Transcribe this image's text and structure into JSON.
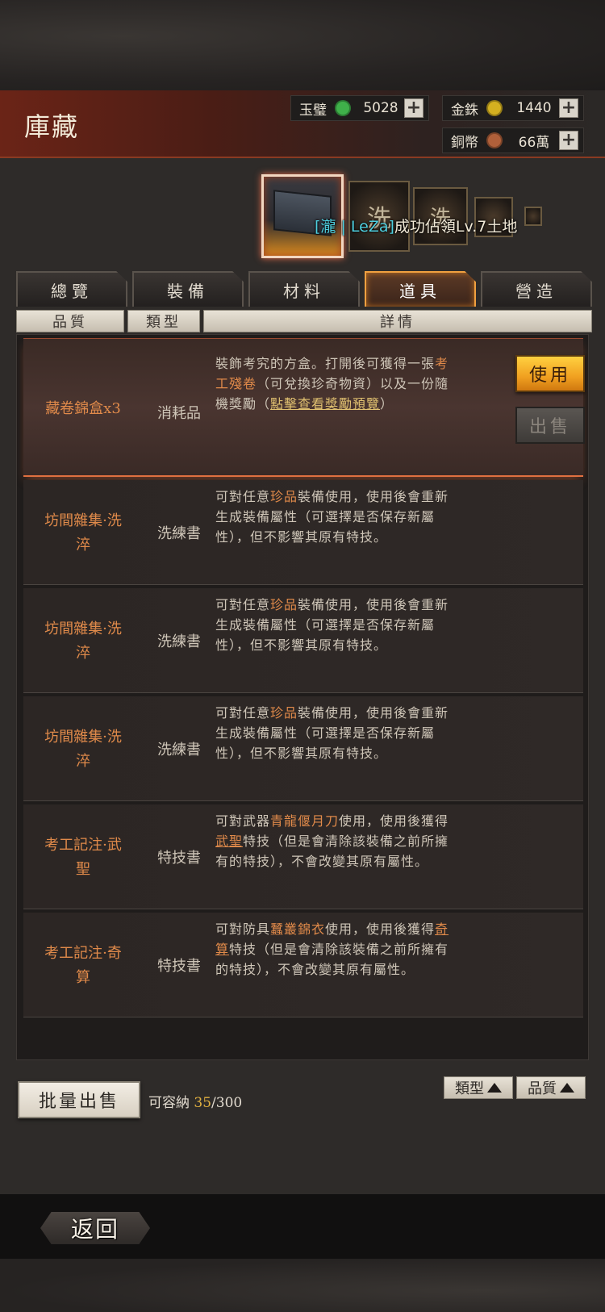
{
  "header": {
    "title": "庫藏"
  },
  "currencies": [
    {
      "label": "玉璧",
      "value": "5028",
      "coin_color": "#3fb04a"
    },
    {
      "label": "金銖",
      "value": "1440",
      "coin_color": "#d4b020"
    },
    {
      "label": "銅幣",
      "value": "66萬",
      "coin_color": "#b0603a"
    }
  ],
  "reward_glyphs": [
    "洗",
    "洗"
  ],
  "toast": {
    "alliance": "[瀧 | LeZa]",
    "message": "成功佔領Lv.7土地"
  },
  "tabs": [
    {
      "label": "總覽"
    },
    {
      "label": "裝備"
    },
    {
      "label": "材料"
    },
    {
      "label": "道具",
      "active": true
    },
    {
      "label": "營造"
    }
  ],
  "columns": {
    "quality": "品質",
    "type": "類型",
    "detail": "詳情"
  },
  "items": [
    {
      "name": "藏卷錦盒x3",
      "type": "消耗品",
      "desc_1": "裝飾考究的方盒。打開後可獲得一張",
      "desc_hl": "考工殘卷",
      "desc_2": "（可兌換珍奇物資）以及一份隨機獎勵（",
      "desc_link": "點擊查看獎勵預覽",
      "desc_3": "）",
      "use_label": "使用",
      "sell_label": "出售"
    },
    {
      "name_1": "坊間雜集·洗",
      "name_2": "淬",
      "type": "洗練書",
      "desc_1": "可對任意",
      "desc_hl": "珍品",
      "desc_2": "裝備使用，使用後會重新生成裝備屬性（可選擇是否保存新屬性），但不影響其原有特技。"
    },
    {
      "name_1": "坊間雜集·洗",
      "name_2": "淬",
      "type": "洗練書",
      "desc_1": "可對任意",
      "desc_hl": "珍品",
      "desc_2": "裝備使用，使用後會重新生成裝備屬性（可選擇是否保存新屬性），但不影響其原有特技。"
    },
    {
      "name_1": "坊間雜集·洗",
      "name_2": "淬",
      "type": "洗練書",
      "desc_1": "可對任意",
      "desc_hl": "珍品",
      "desc_2": "裝備使用，使用後會重新生成裝備屬性（可選擇是否保存新屬性），但不影響其原有特技。"
    },
    {
      "name_1": "考工記注·武",
      "name_2": "聖",
      "type": "特技書",
      "desc_1": "可對武器",
      "desc_hl": "青龍偃月刀",
      "desc_2": "使用，使用後獲得",
      "desc_hl2": "武聖",
      "desc_3": "特技（但是會清除該裝備之前所擁有的特技），不會改變其原有屬性。"
    },
    {
      "name_1": "考工記注·奇",
      "name_2": "算",
      "type": "特技書",
      "desc_1": "可對防具",
      "desc_hl": "蠶叢錦衣",
      "desc_2": "使用，使用後獲得",
      "desc_hl2": "奇算",
      "desc_3": "特技（但是會清除該裝備之前所擁有的特技），不會改變其原有屬性。"
    }
  ],
  "footer": {
    "bulk_sell": "批量出售",
    "capacity_label": "可容納",
    "capacity_current": "35",
    "capacity_max": "/300",
    "sort_type": "類型",
    "sort_quality": "品質",
    "back": "返回"
  }
}
